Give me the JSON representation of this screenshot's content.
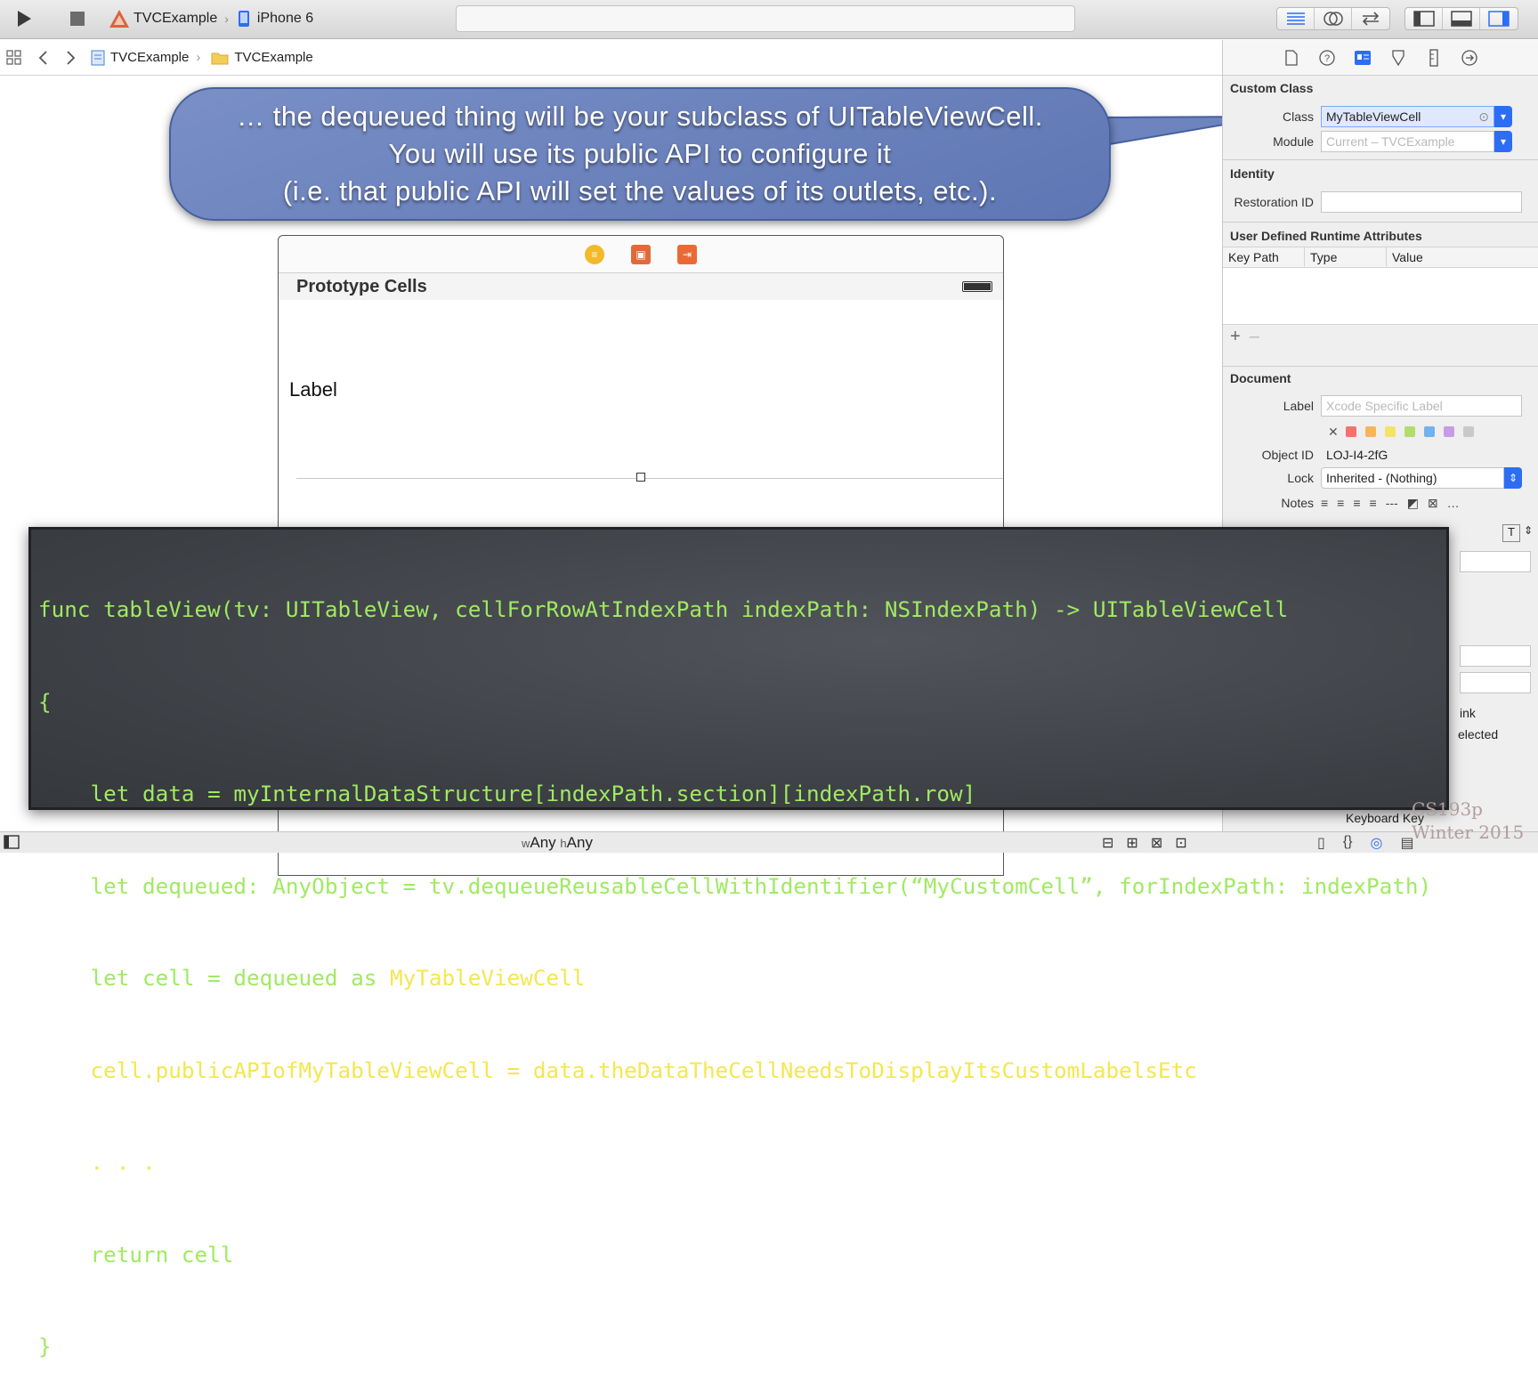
{
  "toolbar": {
    "scheme_app": "TVCExample",
    "scheme_device": "iPhone 6"
  },
  "jumpbar": {
    "crumb1": "TVCExample",
    "crumb2": "TVCExample"
  },
  "callout": {
    "line1": "… the dequeued thing will be your subclass of UITableViewCell.",
    "line2": "You will use its public API to configure it",
    "line3": "(i.e. that public API will set the values of its outlets, etc.)."
  },
  "scene": {
    "section_title": "Prototype Cells",
    "cell_label": "Label"
  },
  "inspector": {
    "custom_class": {
      "header": "Custom Class",
      "class_label": "Class",
      "class_value": "MyTableViewCell",
      "module_label": "Module",
      "module_placeholder": "Current – TVCExample"
    },
    "identity": {
      "header": "Identity",
      "restoration_label": "Restoration ID",
      "restoration_value": ""
    },
    "udra": {
      "header": "User Defined Runtime Attributes",
      "col_key": "Key Path",
      "col_type": "Type",
      "col_value": "Value",
      "add": "+",
      "remove": "–"
    },
    "document": {
      "header": "Document",
      "label_label": "Label",
      "label_placeholder": "Xcode Specific Label",
      "object_id_label": "Object ID",
      "object_id_value": "LOJ-I4-2fG",
      "lock_label": "Lock",
      "lock_value": "Inherited - (Nothing)",
      "notes_label": "Notes"
    },
    "partial": {
      "link": "ink",
      "selected": "elected",
      "keyboard": "Keyboard Key"
    },
    "label_colors": [
      "#f1736d",
      "#f6b55a",
      "#f3e36a",
      "#b2dd6c",
      "#74b2ee",
      "#c89be6",
      "#c9c9c9"
    ]
  },
  "code": {
    "line1": "func tableView(tv: UITableView, cellForRowAtIndexPath indexPath: NSIndexPath) -> UITableViewCell",
    "line2": "{",
    "line3": "    let data = myInternalDataStructure[indexPath.section][indexPath.row]",
    "line4": "    let dequeued: AnyObject = tv.dequeueReusableCellWithIdentifier(“MyCustomCell”, forIndexPath: indexPath)",
    "line5_a": "    let cell = dequeued as ",
    "line5_b": "MyTableViewCell",
    "line6": "    cell.publicAPIofMyTableViewCell = data.theDataTheCellNeedsToDisplayItsCustomLabelsEtc",
    "line7": "    . . .",
    "line8": "    return cell",
    "line9": "}"
  },
  "bottombar": {
    "w_prefix": "w",
    "w_value": "Any",
    "h_prefix": "h",
    "h_value": "Any"
  },
  "watermark": {
    "line1": "CS193p",
    "line2": "Winter 2015"
  },
  "colors": {
    "accent": "#2d6df5",
    "code_text": "#9fea62",
    "code_highlight": "#f3e74f",
    "callout_fill": "#6e84bf"
  }
}
